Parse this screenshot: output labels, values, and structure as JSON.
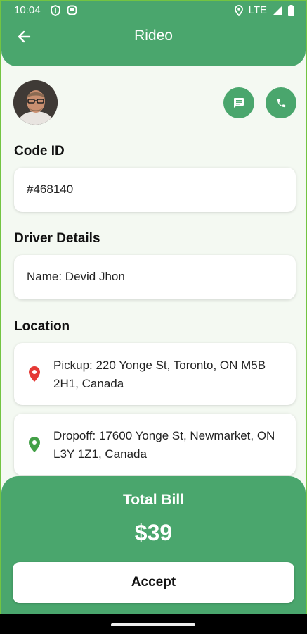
{
  "status_bar": {
    "time": "10:04",
    "network": "LTE"
  },
  "app_bar": {
    "title": "Rideo",
    "back_icon": "arrow-left-icon"
  },
  "actions": {
    "message_icon": "message-icon",
    "call_icon": "phone-icon"
  },
  "code": {
    "title": "Code ID",
    "value": "#468140"
  },
  "driver": {
    "title": "Driver Details",
    "name": "Name: Devid Jhon"
  },
  "location": {
    "title": "Location",
    "pickup": "Pickup: 220 Yonge St, Toronto, ON M5B 2H1, Canada",
    "dropoff": "Dropoff: 17600 Yonge St, Newmarket, ON L3Y 1Z1, Canada",
    "pickup_pin_color": "#e53935",
    "dropoff_pin_color": "#43a047"
  },
  "bill": {
    "label": "Total Bill",
    "amount": "$39",
    "accept_label": "Accept"
  },
  "colors": {
    "primary": "#4aa66d",
    "background": "#f4f9f2"
  }
}
